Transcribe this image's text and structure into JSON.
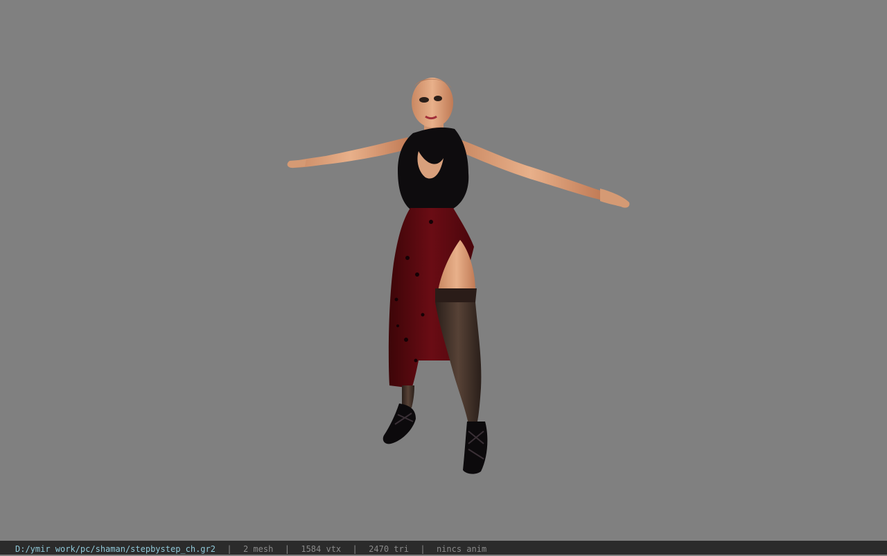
{
  "viewer": {
    "background_color": "#808080",
    "model": {
      "outfit_top_color": "#0e0c0e",
      "skirt_color": "#5a0a10",
      "skin_color": "#d9a07a",
      "stocking_color": "#3a2c26"
    }
  },
  "statusbar": {
    "file_path": "D:/ymir work/pc/shaman/stepbystep_ch.gr2",
    "separator": "|",
    "mesh_count": "2 mesh",
    "vertex_count": "1584 vtx",
    "triangle_count": "2470 tri",
    "anim_status": "nincs anim"
  }
}
